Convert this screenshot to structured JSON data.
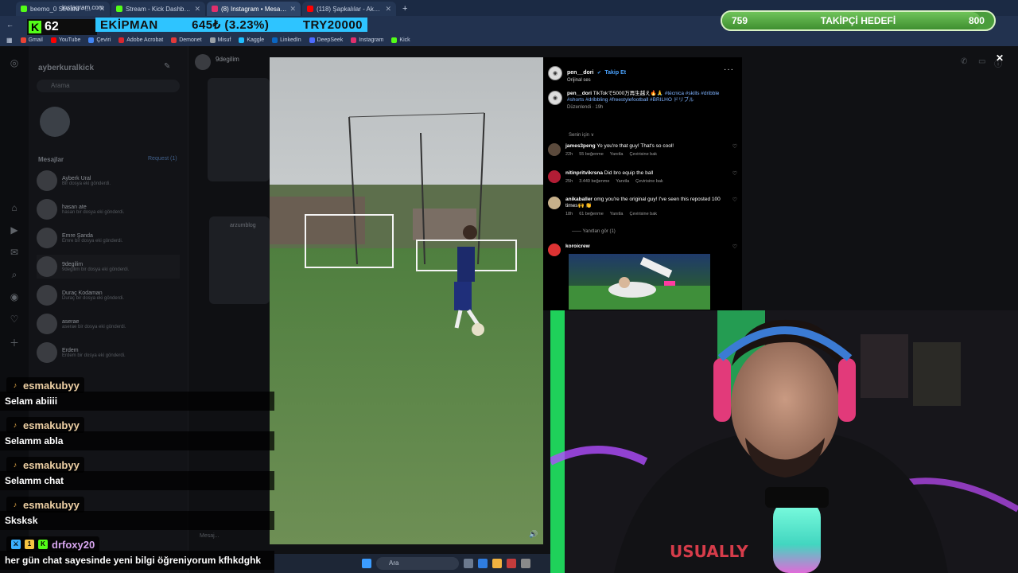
{
  "browser": {
    "tabs": [
      {
        "title": "beemo_0 Stream - Watch Live",
        "color": "#53fc18",
        "active": false
      },
      {
        "title": "Stream - Kick Dashboard",
        "color": "#53fc18",
        "active": false
      },
      {
        "title": "(8) Instagram • Mesajlar",
        "color": "#e1306c",
        "active": true
      },
      {
        "title": "(118) Şapkalılar - Aksoy Dub S",
        "color": "#ff0000",
        "active": false
      }
    ],
    "new_tab": "+",
    "url": "instagram.com",
    "bookmarks": [
      {
        "label": "Gmail",
        "color": "#ea4335"
      },
      {
        "label": "YouTube",
        "color": "#ff0000"
      },
      {
        "label": "Çeviri",
        "color": "#4285f4"
      },
      {
        "label": "Adobe Acrobat",
        "color": "#d7282f"
      },
      {
        "label": "Demonet",
        "color": "#e23a3a"
      },
      {
        "label": "Misuf",
        "color": "#9aa0a6"
      },
      {
        "label": "Kaggle",
        "color": "#20beff"
      },
      {
        "label": "LinkedIn",
        "color": "#0a66c2"
      },
      {
        "label": "DeepSeek",
        "color": "#4d6bfe"
      },
      {
        "label": "Instagram",
        "color": "#e1306c"
      },
      {
        "label": "Kick",
        "color": "#53fc18"
      }
    ]
  },
  "overlay": {
    "kick_count": "62",
    "goal_label": "EKİPMAN",
    "goal_progress": "645₺ (3.23%)",
    "goal_target": "TRY20000",
    "follower_current": "759",
    "follower_label": "TAKİPÇİ HEDEFİ",
    "follower_target": "800",
    "follower_fraction": 0.949
  },
  "instagram": {
    "username": "ayberkuralkick",
    "search_placeholder": "Arama",
    "messages_heading": "Mesajlar",
    "requests": "Request (1)",
    "conversations": [
      {
        "name": "Ayberk Ural",
        "preview": "Bir dosya eki gönderdi."
      },
      {
        "name": "hasan ate",
        "preview": "hasan bir dosya eki gönderdi."
      },
      {
        "name": "Emre Şanda",
        "preview": "Emre bir dosya eki gönderdi."
      },
      {
        "name": "9degilim",
        "preview": "9degilim bir dosya eki gönderdi."
      },
      {
        "name": "Duraç Kodaman",
        "preview": "Duraç bir dosya eki gönderdi."
      },
      {
        "name": "aserae",
        "preview": "aserae bir dosya eki gönderdi."
      },
      {
        "name": "Erdem",
        "preview": "Erdem bir dosya eki gönderdi."
      }
    ],
    "chat_name": "9degilim",
    "chat_partner": "arzumblog",
    "message_placeholder": "Mesaj..."
  },
  "post": {
    "author": "pen__dori",
    "follow": "Takip Et",
    "audio": "Orijinal ses",
    "caption_author": "pen__dori",
    "caption": "TikTokで5000万再生越え🔥🙏 ",
    "caption_tags": "#técnica #skills #dribble #shorts #dribbling #freestylefootball #BRILHO ドリブル",
    "caption_meta": "Düzenlendi · 19h",
    "for_you": "Senin için ∨",
    "comments": [
      {
        "user": "james3peng",
        "text": "Yo you're that guy! That's so cool!",
        "time": "22h",
        "likes": "55 beğenme",
        "reply": "Yanıtla",
        "translate": "Çevirisine bak",
        "color": "#5b4a3c"
      },
      {
        "user": "nitinpritvikrsna",
        "text": "Did bro equip the ball",
        "time": "25h",
        "likes": "3.449 beğenme",
        "reply": "Yanıtla",
        "translate": "Çevirisine bak",
        "color": "#b21d35"
      },
      {
        "user": "anikaballer",
        "text": "omg you're the original guy! I've seen this reposted 100 times🙌 👏",
        "time": "18h",
        "likes": "61 beğenme",
        "reply": "Yanıtla",
        "translate": "Çevirisine bak",
        "color": "#c7b08a"
      }
    ],
    "view_replies": "——   Yanıtları gör (1)",
    "repost_user": "koroicrew"
  },
  "chat": [
    {
      "user": "esmakubyy",
      "text": "Selam abiiii"
    },
    {
      "user": "esmakubyy",
      "text": "Selamm abla"
    },
    {
      "user": "esmakubyy",
      "text": "Selamm chat"
    },
    {
      "user": "esmakubyy",
      "text": "Sksksk"
    },
    {
      "user": "drfoxy20",
      "text": "her gün chat sayesinde yeni bilgi öğreniyorum kfhkdghk"
    }
  ],
  "taskbar": {
    "search": "Ara"
  }
}
